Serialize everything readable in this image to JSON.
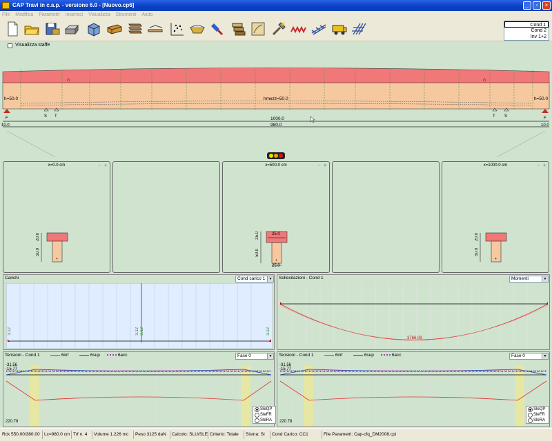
{
  "window": {
    "title": "CAP Travi in c.a.p. - versione 6.0 - [Nuovo.cp6]"
  },
  "menu": [
    "File",
    "Modifica",
    "Parametri",
    "Inserisci",
    "Visualizza",
    "Strumenti",
    "Aiuto"
  ],
  "toolbar_icons": [
    "new-file-icon",
    "open-folder-icon",
    "save-icon",
    "print-icon",
    "box-3d-icon",
    "beam-section-icon",
    "section-stack-icon",
    "beam-ruler-icon",
    "scatter-grid-icon",
    "bowl-icon",
    "paint-icon",
    "stack-icon",
    "map-icon",
    "wand-hammer-icon",
    "spring-icon",
    "truss-icon",
    "truck-icon",
    "grid-structure-icon"
  ],
  "conditions": {
    "items": [
      "Cond 1",
      "Cond 2",
      "Inv 1+2"
    ],
    "selected": "Cond 1"
  },
  "options": {
    "show_stirrups_label": "Visualizza staffe"
  },
  "beam": {
    "h_left": "h=50.0",
    "h_mid": "hmezz=50.0",
    "h_right": "h=50.0",
    "total_length": "1000.0",
    "span_length": "980.0",
    "end_left": "10.0",
    "end_right": "10.0",
    "marks_left": [
      "S",
      "T"
    ],
    "marks_right": [
      "T",
      "S"
    ],
    "support_left": "F",
    "support_right": "F"
  },
  "sections": [
    {
      "title": "x=0.0 cm",
      "dim_h1": "20.0",
      "dim_h2": "50.0"
    },
    {
      "title": ""
    },
    {
      "title": "x=500.0 cm",
      "dim_h1": "25.0",
      "dim_h2": "50.0",
      "dim_top": "25.0",
      "dim_bot": "25.0"
    },
    {
      "title": ""
    },
    {
      "title": "x=1000.0 cm",
      "dim_h1": "20.0",
      "dim_h2": "50.0"
    }
  ],
  "loads": {
    "title": "Carichi",
    "combo": "Cond carico 1",
    "labels": [
      "3.12",
      "3.12",
      "3.12",
      "3.12"
    ]
  },
  "stresses": {
    "title": "Sollecitazioni - Cond 1",
    "combo": "Momenti",
    "value_label": "3766.09"
  },
  "tension_left": {
    "title": "Tensioni - Cond 1",
    "legend": [
      "6inf",
      "6sup",
      "6acc"
    ],
    "combo": "Fase 0",
    "y_top": "-31.56",
    "y_second": "-15.77",
    "y_bottom": "220.78",
    "radios": [
      "SleQP",
      "SleFR",
      "SleRA"
    ],
    "radio_selected": "SleQP"
  },
  "tension_right": {
    "title": "Tensioni - Cond 1",
    "legend": [
      "6inf",
      "6sup",
      "6acc"
    ],
    "combo": "Fase 0",
    "y_top": "-31.56",
    "y_second": "-15.77",
    "y_bottom": "220.78",
    "radios": [
      "SleQP",
      "SleFR",
      "SleRA"
    ],
    "radio_selected": "SleQP"
  },
  "status": {
    "rck": "Rck 550.00/380.00",
    "lc": "Lc=980.0 cm",
    "trf": "Trf n. 4",
    "volume": "Volume 1.226 mc",
    "peso": "Peso 3125 daN",
    "calcolo": "Calcolo: SLU/SLE",
    "criterio": "Criterio: Totale",
    "sisma": "Sisma: SI",
    "cond": "Cond Carico: CC1",
    "file": "File Parametri: Cap-cfq_DM2008.cpi"
  },
  "colors": {
    "flange": "#f07878",
    "web": "#f5c8a0",
    "background": "#cfe3cf",
    "chart_bg": "#e0ecff"
  }
}
